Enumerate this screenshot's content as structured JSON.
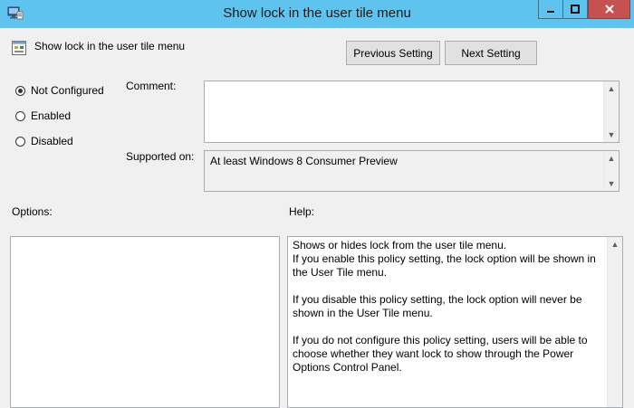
{
  "window": {
    "title": "Show lock in the user tile menu"
  },
  "header": {
    "policy_name": "Show lock in the user tile menu",
    "previous_setting": "Previous Setting",
    "next_setting": "Next Setting"
  },
  "state": {
    "options": [
      {
        "label": "Not Configured",
        "selected": true
      },
      {
        "label": "Enabled",
        "selected": false
      },
      {
        "label": "Disabled",
        "selected": false
      }
    ]
  },
  "comment": {
    "label": "Comment:",
    "value": ""
  },
  "supported_on": {
    "label": "Supported on:",
    "value": "At least Windows 8 Consumer Preview"
  },
  "options_section": {
    "label": "Options:"
  },
  "help": {
    "label": "Help:",
    "paragraphs": [
      "Shows or hides lock from the user tile menu.",
      "If you enable this policy setting, the lock option will be shown in the User Tile menu.",
      "If you disable this policy setting, the lock option will never be shown in the User Tile menu.",
      "If you do not configure this policy setting, users will be able to choose whether they want lock to show through the Power Options Control Panel."
    ]
  },
  "icons": {
    "app": "policy-editor-icon",
    "policy": "policy-setting-icon",
    "minimize": "minimize-icon",
    "maximize": "maximize-icon",
    "close": "close-icon"
  },
  "colors": {
    "titlebar": "#5ec4ef",
    "close_button": "#c75050",
    "dialog_background": "#f0f0f0"
  }
}
